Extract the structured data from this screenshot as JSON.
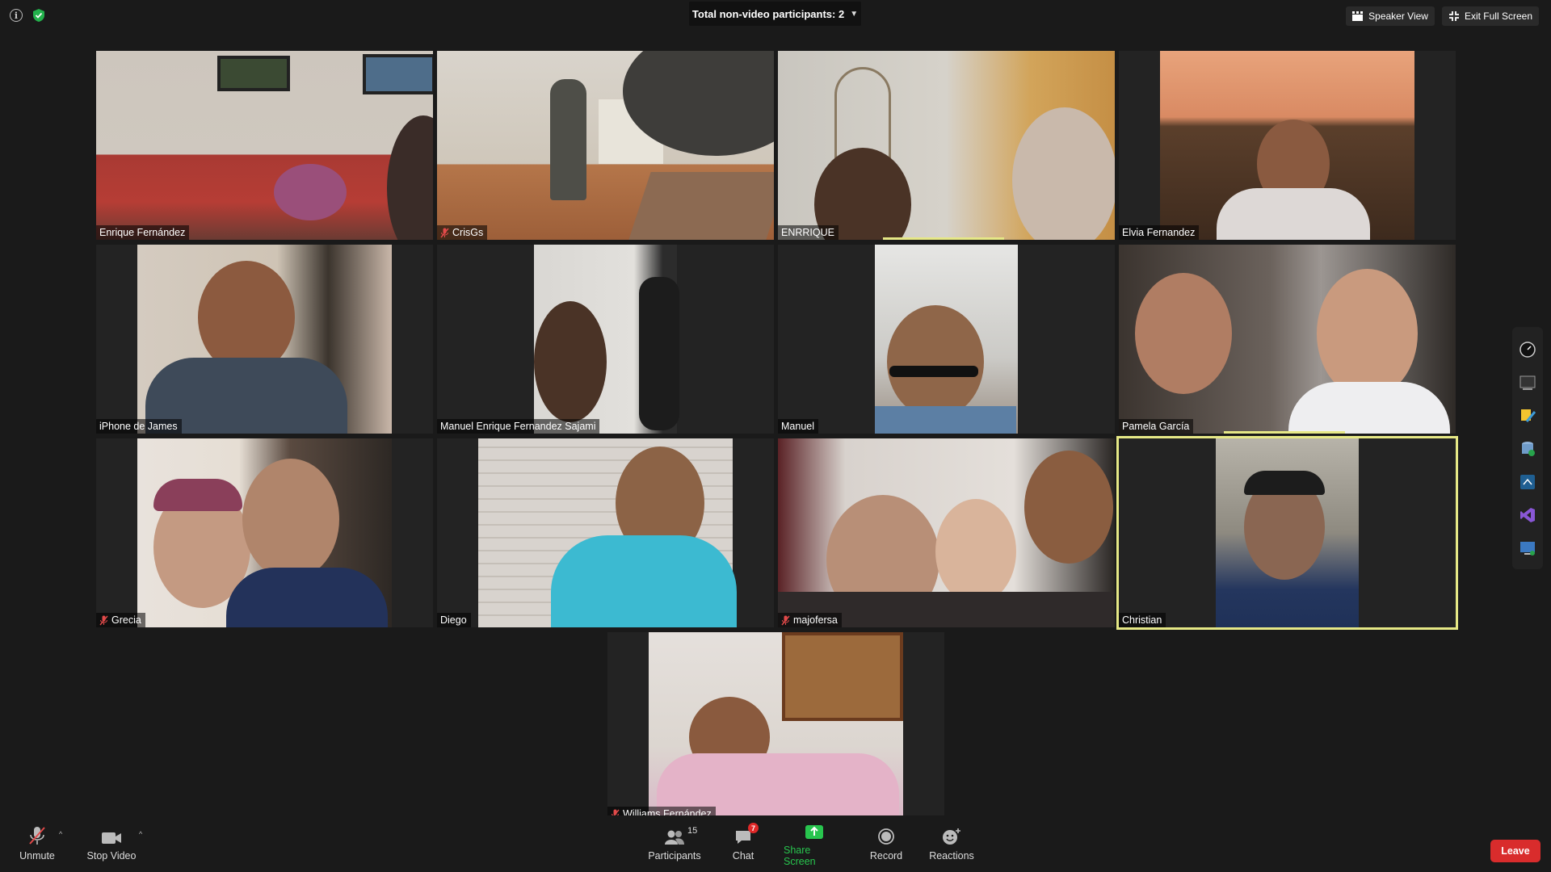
{
  "window": {
    "nonvideo_label": "Total non-video participants: 2",
    "speaker_view": "Speaker View",
    "exit_fullscreen": "Exit Full Screen"
  },
  "participants": [
    {
      "name": "Enrique Fernández",
      "muted": false
    },
    {
      "name": "CrisGs",
      "muted": true
    },
    {
      "name": "ENRRIQUE",
      "muted": false
    },
    {
      "name": "Elvia Fernandez",
      "muted": false
    },
    {
      "name": "iPhone de James",
      "muted": false
    },
    {
      "name": "Manuel Enrique Fernandez Sajami",
      "muted": false
    },
    {
      "name": "Manuel",
      "muted": false
    },
    {
      "name": "Pamela García",
      "muted": false
    },
    {
      "name": "Grecia",
      "muted": true
    },
    {
      "name": "Diego",
      "muted": false
    },
    {
      "name": "majofersa",
      "muted": true
    },
    {
      "name": "Christian",
      "muted": false
    },
    {
      "name": "Williams Fernández",
      "muted": true
    }
  ],
  "toolbar": {
    "unmute": "Unmute",
    "stop_video": "Stop Video",
    "participants": "Participants",
    "participants_count": "15",
    "chat": "Chat",
    "chat_badge": "7",
    "share_screen": "Share Screen",
    "record": "Record",
    "reactions": "Reactions",
    "leave": "Leave"
  },
  "colors": {
    "background": "#1a1a1a",
    "active_speaker": "#e6e886",
    "share_green": "#28c54e",
    "leave_red": "#d92c2c",
    "chat_badge_red": "#e02828"
  }
}
